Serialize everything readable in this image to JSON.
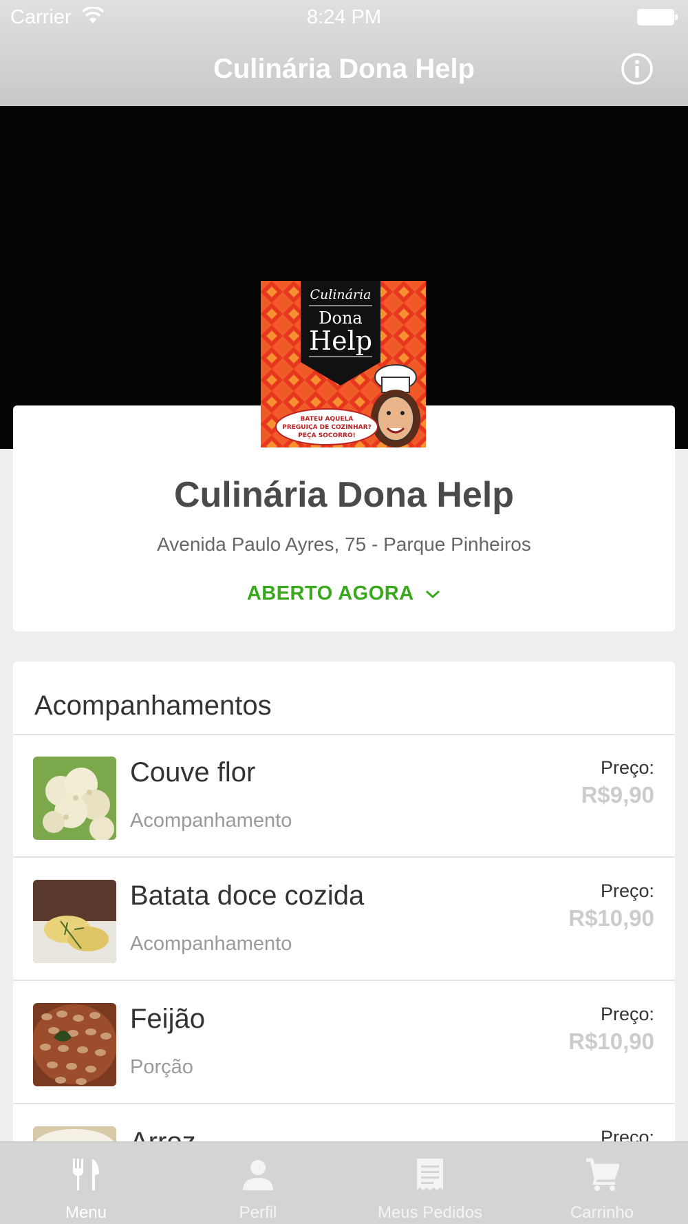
{
  "status_bar": {
    "carrier": "Carrier",
    "time": "8:24 PM"
  },
  "nav": {
    "title": "Culinária Dona Help",
    "info_icon": "info-icon"
  },
  "restaurant": {
    "name": "Culinária Dona Help",
    "address": "Avenida Paulo Ayres, 75 - Parque Pinheiros",
    "status": "ABERTO AGORA",
    "status_color": "#3aa81c",
    "logo": {
      "line1": "Culinária",
      "line2": "Dona",
      "line3": "Help",
      "bubble1": "BATEU AQUELA",
      "bubble2": "PREGUIÇA DE COZINHAR?",
      "bubble3": "PEÇA SOCORRO!"
    }
  },
  "menu": {
    "section_title": "Acompanhamentos",
    "items": [
      {
        "name": "Couve flor",
        "category": "Acompanhamento",
        "price_label": "Preço:",
        "price": "R$9,90"
      },
      {
        "name": "Batata doce cozida",
        "category": "Acompanhamento",
        "price_label": "Preço:",
        "price": "R$10,90"
      },
      {
        "name": "Feijão",
        "category": "Porção",
        "price_label": "Preço:",
        "price": "R$10,90"
      },
      {
        "name": "Arroz",
        "category": "",
        "price_label": "Preço:",
        "price": ""
      }
    ]
  },
  "tabs": [
    {
      "label": "Menu",
      "icon": "fork-knife-icon",
      "active": true
    },
    {
      "label": "Perfil",
      "icon": "person-icon",
      "active": false
    },
    {
      "label": "Meus Pedidos",
      "icon": "receipt-icon",
      "active": false
    },
    {
      "label": "Carrinho",
      "icon": "cart-icon",
      "active": false
    }
  ],
  "colors": {
    "accent_green": "#3aa81c",
    "price_gray": "#cccccc",
    "tab_bar": "#d4d4d4"
  }
}
